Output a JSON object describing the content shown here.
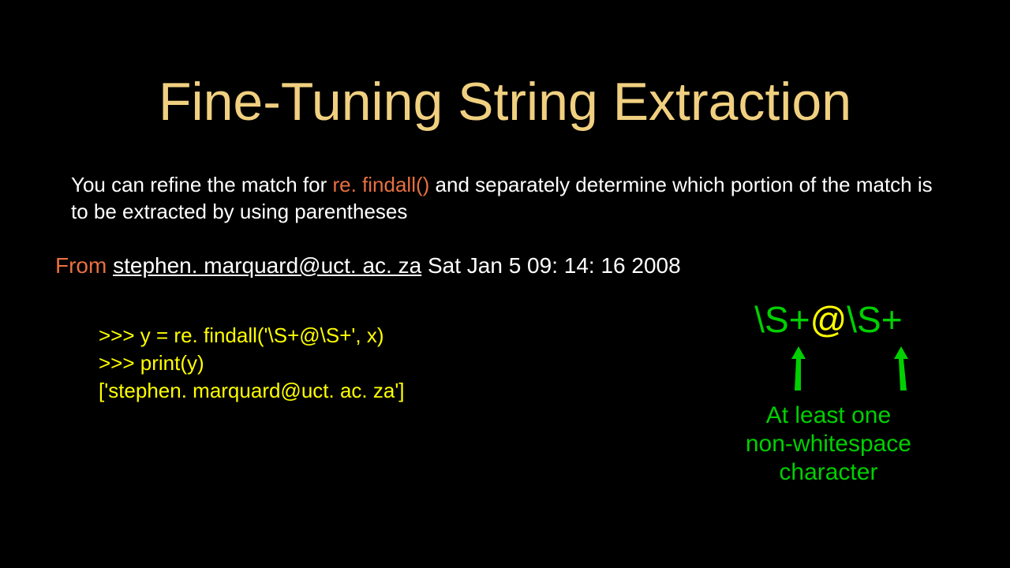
{
  "title": "Fine-Tuning String Extraction",
  "description": {
    "before": "You can refine the match for ",
    "highlight": "re. findall()",
    "after": " and separately determine which portion of the match is to be extracted by using parentheses"
  },
  "example": {
    "from_label": "From ",
    "email": "stephen. marquard@uct. ac. za",
    "timestamp": " Sat Jan  5 09: 14: 16 2008"
  },
  "code": {
    "line1": ">>> y = re. findall('\\S+@\\S+', x)",
    "line2": ">>> print(y)",
    "line3": "['stephen. marquard@uct. ac. za']"
  },
  "regex": {
    "part1": "\\S+",
    "part2": "@",
    "part3": "\\S+"
  },
  "annotation": {
    "line1": "At least one",
    "line2": "non-whitespace",
    "line3": "character"
  }
}
